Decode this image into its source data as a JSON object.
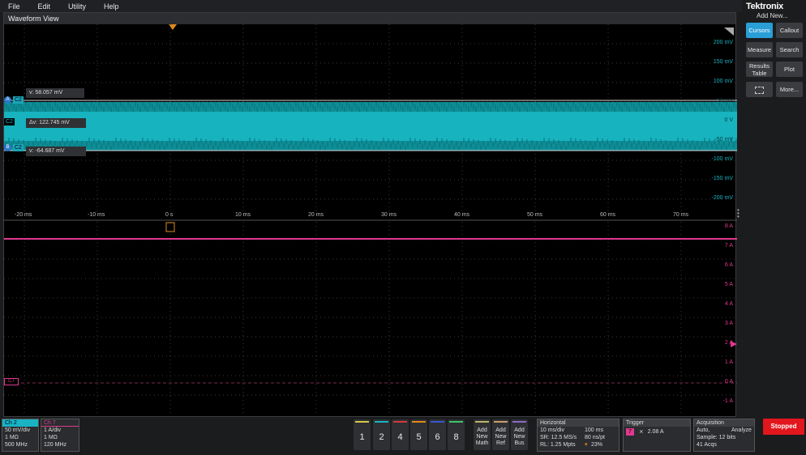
{
  "menu": {
    "file": "File",
    "edit": "Edit",
    "utility": "Utility",
    "help": "Help"
  },
  "waveform_view": {
    "title": "Waveform View",
    "trigger_marker": "T"
  },
  "upper_y_labels": [
    "200 mV",
    "150 mV",
    "100 mV",
    "",
    "",
    "",
    "-100 mV",
    "-150 mV",
    "-200 mV"
  ],
  "upper_y_right": [
    "50 mV",
    "0 V",
    "-50 mV"
  ],
  "x_labels": [
    "-20 ms",
    "-10 ms",
    "0 s",
    "10 ms",
    "20 ms",
    "30 ms",
    "40 ms",
    "50 ms",
    "60 ms",
    "70 ms"
  ],
  "lower_y_labels": [
    "8 A",
    "7 A",
    "6 A",
    "5 A",
    "4 A",
    "3 A",
    "2 A",
    "1 A",
    "0 A",
    "-1 A"
  ],
  "cursors": {
    "a_badge": "A",
    "b_badge": "B",
    "ch_tag": "C2",
    "a_value": "v: 58.057 mV",
    "delta": "Δv: 122.745 mV",
    "b_value": "v: -64.687 mV",
    "ch2_tag": "C2"
  },
  "c7_tag": "C7",
  "colors": {
    "ch2": "#19b3c3",
    "ch7": "#e0388f",
    "trigger": "#e08a1b",
    "accent": "#2a9ed6",
    "stop": "#e2161d"
  },
  "right_panel": {
    "logo": "Tektronix",
    "add_new": "Add New...",
    "buttons": {
      "cursors": "Cursors",
      "callout": "Callout",
      "measure": "Measure",
      "search": "Search",
      "results1": "Results",
      "results2": "Table",
      "plot": "Plot",
      "more": "More..."
    }
  },
  "bottom": {
    "ch2": {
      "hdr": "Ch 2",
      "r1": "50 mV/div",
      "r2": "1 MΩ",
      "r3": "500 MHz"
    },
    "ch7": {
      "hdr": "Ch 7",
      "r1": "1 A/div",
      "r2": "1 MΩ",
      "r3": "120 MHz"
    },
    "channels": [
      "1",
      "2",
      "4",
      "5",
      "6",
      "8"
    ],
    "add_math": [
      "Add",
      "New",
      "Math"
    ],
    "add_ref": [
      "Add",
      "New",
      "Ref"
    ],
    "add_bus": [
      "Add",
      "New",
      "Bus"
    ],
    "horizontal": {
      "hdr": "Horizontal",
      "r1a": "10 ms/div",
      "r1b": "100 ms",
      "r2a": "SR: 12.5 MS/s",
      "r2b": "80 ns/pt",
      "r3a": "RL: 1.25 Mpts",
      "r3b": "23%"
    },
    "trigger": {
      "hdr": "Trigger",
      "ch": "7",
      "val": "2.08 A"
    },
    "acquisition": {
      "hdr": "Acquisition",
      "r1a": "Auto,",
      "r1b": "Analyze",
      "r2a": "Sample: 12 bits",
      "r3a": "41 Acqs"
    },
    "stopped": "Stopped"
  }
}
